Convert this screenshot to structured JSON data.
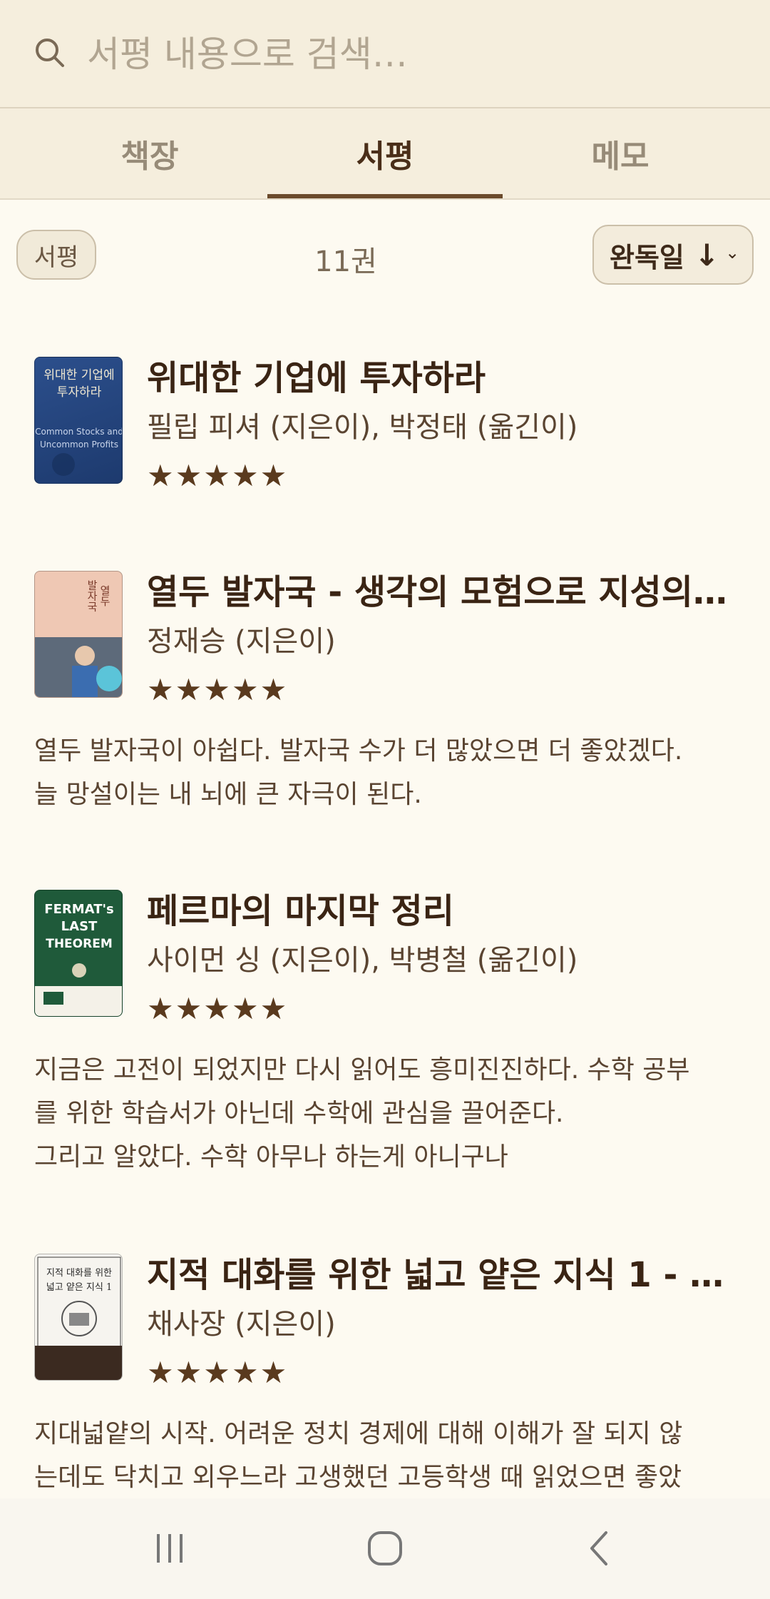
{
  "search": {
    "placeholder": "서평 내용으로 검색…"
  },
  "tabs": [
    {
      "label": "책장",
      "active": false
    },
    {
      "label": "서평",
      "active": true
    },
    {
      "label": "메모",
      "active": false
    }
  ],
  "toolbar": {
    "filter_chip": "서평",
    "count": "11권",
    "sort_label": "완독일",
    "sort_arrow": "↓",
    "sort_caret": "⌄"
  },
  "books": [
    {
      "title": "위대한 기업에 투자하라",
      "authors": "필립 피셔 (지은이), 박정태 (옮긴이)",
      "stars": "★★★★★",
      "rating": 5,
      "cover_text": [
        "위대한 기업에",
        "투자하라",
        "Common Stocks and",
        "Uncommon Profits"
      ],
      "review_lines": []
    },
    {
      "title": "열두 발자국 - 생각의 모험으로 지성의 …",
      "authors": "정재승 (지은이)",
      "stars": "★★★★★",
      "rating": 5,
      "cover_text": [
        "열두",
        "발자국"
      ],
      "review_lines": [
        "열두 발자국이 아쉽다. 발자국 수가 더 많았으면 더 좋았겠다.",
        "늘 망설이는 내 뇌에 큰 자극이 된다."
      ]
    },
    {
      "title": "페르마의 마지막 정리",
      "authors": "사이먼 싱 (지은이), 박병철 (옮긴이)",
      "stars": "★★★★★",
      "rating": 5,
      "cover_text": [
        "FERMAT's",
        "LAST",
        "THEOREM"
      ],
      "review_lines": [
        "지금은 고전이 되었지만 다시 읽어도 흥미진진하다. 수학 공부",
        "를 위한 학습서가 아닌데 수학에 관심을 끌어준다.",
        "그리고 알았다. 수학 아무나 하는게 아니구나"
      ]
    },
    {
      "title": "지적 대화를 위한 넓고 얕은 지식 1 - …",
      "authors": "채사장 (지은이)",
      "stars": "★★★★★",
      "rating": 5,
      "cover_text": [
        "지적 대화를 위한",
        "넓고 얕은 지식 1"
      ],
      "review_lines": [
        "지대넓얕의 시작. 어려운 정치 경제에 대해 이해가 잘 되지 않",
        "는데도 닥치고 외우느라 고생했던 고등학생 때 읽었으면 좋았"
      ]
    }
  ],
  "colors": {
    "accent": "#6b4a2b",
    "background": "#fdfaf1",
    "header": "#f5eedd"
  }
}
